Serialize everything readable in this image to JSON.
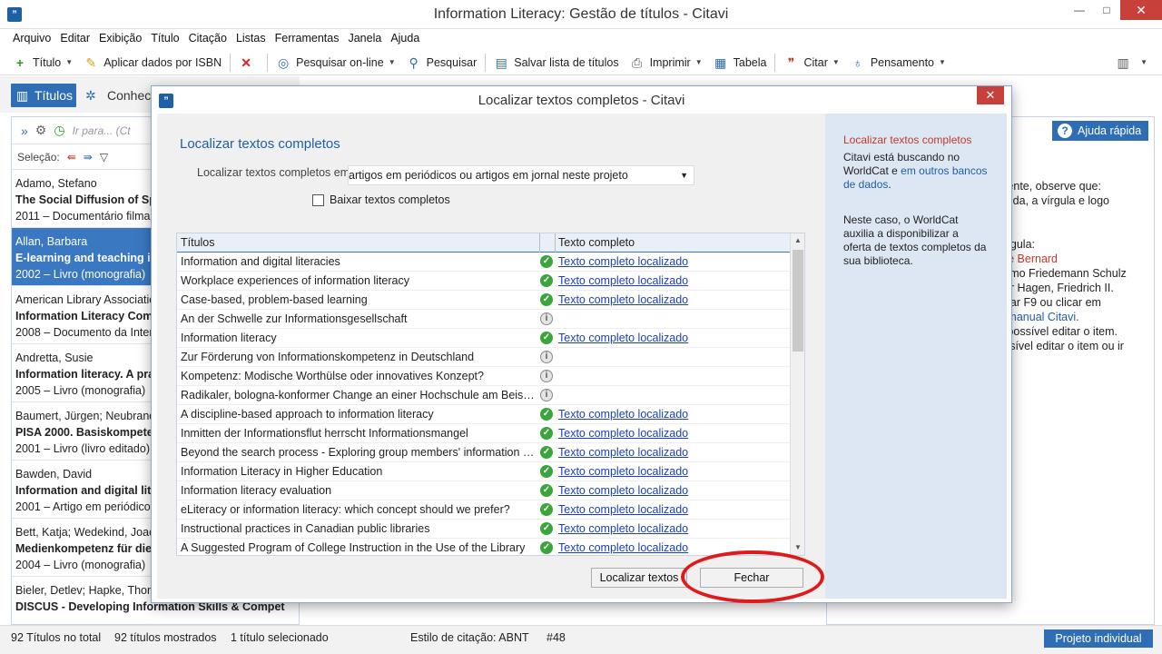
{
  "window": {
    "title": "Information Literacy: Gestão de títulos - Citavi",
    "app_icon": "”",
    "minimize": "—",
    "maximize": "□",
    "close": "✕"
  },
  "menu": [
    "Arquivo",
    "Editar",
    "Exibição",
    "Título",
    "Citação",
    "Listas",
    "Ferramentas",
    "Janela",
    "Ajuda"
  ],
  "toolbar": {
    "titulo": "Título",
    "isbn": "Aplicar dados por ISBN",
    "pesquisar_online": "Pesquisar on-line",
    "pesquisar": "Pesquisar",
    "salvar": "Salvar lista de títulos",
    "imprimir": "Imprimir",
    "tabela": "Tabela",
    "citar": "Citar",
    "pensamento": "Pensamento"
  },
  "left_tabs": {
    "active": "Títulos",
    "inactive": "Conhec"
  },
  "left_panel": {
    "search_placeholder": "Ir para... (Ct",
    "selection_label": "Seleção:",
    "entries": [
      {
        "author": "Adamo, Stefano",
        "title": "The Social Diffusion of Spe",
        "meta": "2011 – Documentário filmac"
      },
      {
        "author": "Allan, Barbara",
        "title": "E-learning and teaching in l",
        "meta": "2002 – Livro (monografia)"
      },
      {
        "author": "American Library Associatio",
        "title": "Information Literacy Comp",
        "meta": "2008 – Documento da Interi"
      },
      {
        "author": "Andretta, Susie",
        "title": "Information literacy. A prac",
        "meta": "2005 – Livro (monografia)"
      },
      {
        "author": "Baumert, Jürgen; Neubrand,",
        "title": "PISA 2000. Basiskompeten:",
        "meta": "2001 – Livro (livro editado)"
      },
      {
        "author": "Bawden, David",
        "title": "Information and digital lite",
        "meta": "2001 – Artigo em periódico"
      },
      {
        "author": "Bett, Katja; Wedekind, Joach",
        "title": "Medienkompetenz für die",
        "meta": "2004 – Livro (monografia)"
      },
      {
        "author": "Bieler, Detlev; Hapke, Thoma",
        "title": "DISCUS - Developing Information Skills & Compet",
        "meta": ""
      }
    ]
  },
  "right_panel": {
    "help_label": "Ajuda rápida",
    "lines": [
      "mente, observe que:",
      "guida, a vírgula e logo",
      "",
      "",
      "vírgula:",
      "rge Bernard",
      "como Friedemann Schulz",
      "der Hagen, Friedrich II.",
      "onar F9 ou clicar em",
      "o manual Citavi.",
      "é possível editar o item.",
      "ossível editar o item ou ir"
    ]
  },
  "statusbar": {
    "total": "92 Títulos no total",
    "shown": "92 títulos mostrados",
    "selected": "1 título selecionado",
    "style": "Estilo de citação: ABNT",
    "number": "#48",
    "project": "Projeto individual"
  },
  "dialog": {
    "title": "Localizar textos completos - Citavi",
    "heading": "Localizar textos completos",
    "find_in_label": "Localizar textos completos em:",
    "find_in_value": "artigos em periódicos ou artigos em jornal neste projeto",
    "download_label": "Baixar textos completos",
    "col_titles": "Títulos",
    "col_full": "Texto completo",
    "rows": [
      {
        "title": "Information and digital literacies",
        "status": "ok",
        "link": "Texto completo localizado"
      },
      {
        "title": "Workplace experiences of information literacy",
        "status": "ok",
        "link": "Texto completo localizado"
      },
      {
        "title": "Case-based, problem-based learning",
        "status": "ok",
        "link": "Texto completo localizado"
      },
      {
        "title": "An der Schwelle zur Informationsgesellschaft",
        "status": "info",
        "link": ""
      },
      {
        "title": "Information literacy",
        "status": "ok",
        "link": "Texto completo localizado"
      },
      {
        "title": "Zur Förderung von Informationskompetenz in Deutschland",
        "status": "info",
        "link": ""
      },
      {
        "title": "Kompetenz: Modische Worthülse oder innovatives Konzept?",
        "status": "info",
        "link": ""
      },
      {
        "title": "Radikaler, bologna-konformer Change an einer Hochschule am Beispi...",
        "status": "info",
        "link": ""
      },
      {
        "title": "A discipline-based approach to information literacy",
        "status": "ok",
        "link": "Texto completo localizado"
      },
      {
        "title": "Inmitten der Informationsflut herrscht Informationsmangel",
        "status": "ok",
        "link": "Texto completo localizado"
      },
      {
        "title": "Beyond the search process - Exploring group members' information b...",
        "status": "ok",
        "link": "Texto completo localizado"
      },
      {
        "title": "Information Literacy in Higher Education",
        "status": "ok",
        "link": "Texto completo localizado"
      },
      {
        "title": "Information literacy evaluation",
        "status": "ok",
        "link": "Texto completo localizado"
      },
      {
        "title": "eLiteracy or information literacy: which concept should we prefer?",
        "status": "ok",
        "link": "Texto completo localizado"
      },
      {
        "title": "Instructional practices in Canadian public libraries",
        "status": "ok",
        "link": "Texto completo localizado"
      },
      {
        "title": "A Suggested Program of College Instruction in the Use of the Library",
        "status": "ok",
        "link": "Texto completo localizado"
      }
    ],
    "btn_find": "Localizar textos",
    "btn_close": "Fechar",
    "side": {
      "heading": "Localizar textos completos",
      "l1": "Citavi está buscando no",
      "l2a": "WorldCat e ",
      "l2b": "em outros bancos",
      "l3": "de dados",
      "l3b": ".",
      "p2": [
        " Neste caso, o WorldCat",
        "auxilia a disponibilizar a",
        "oferta de textos completos da",
        "sua biblioteca."
      ]
    }
  },
  "colors": {
    "accent": "#2f6db5",
    "highlight_oval": "#e01a1a"
  }
}
